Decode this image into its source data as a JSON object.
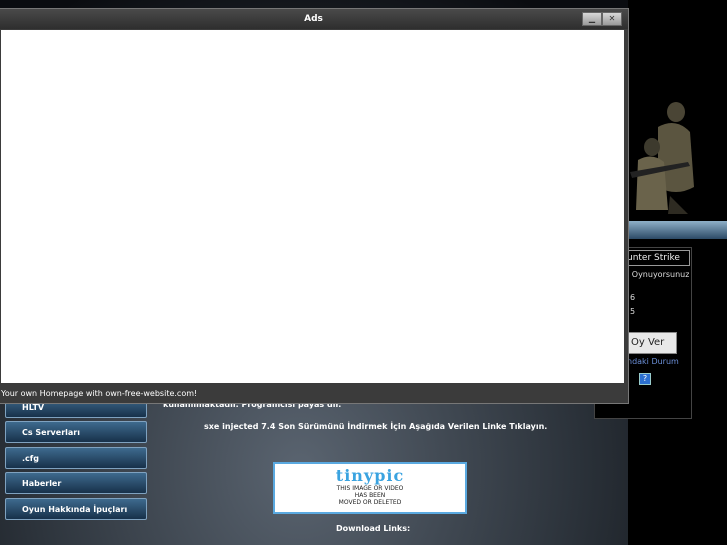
{
  "window": {
    "title": "Ads",
    "status_text": "Your own Homepage with own-free-website.com!",
    "minimize_icon": "minimize-icon",
    "close_icon": "close-icon"
  },
  "menu": {
    "items": [
      "HLTV",
      "Cs Serverları",
      ".cfg",
      "Haberler",
      "Oyun Hakkında İpuçları"
    ]
  },
  "content": {
    "line1": "kullanılmaktadır. Programcısı payas dır.",
    "line2": "sxe injected 7.4 Son Sürümünü İndirmek İçin Aşağıda Verilen Linke Tıklayın.",
    "download_label": "Download Links:"
  },
  "tinypic": {
    "logo": "tinypic",
    "message_line1": "THIS IMAGE OR VIDEO",
    "message_line2": "HAS BEEN",
    "message_line3": "MOVED OR DELETED"
  },
  "poll": {
    "title": "unter Strike",
    "question": "i Oynuyorsunuz?",
    "value1": "6",
    "value2": "5",
    "vote_button": "Oy Ver",
    "status_link": "ndaki Durum",
    "help_icon_text": "?"
  },
  "colors": {
    "window_bg": "#3b3b3b",
    "menu_button": "#2a4e6e",
    "link_blue": "#6b8fd8"
  }
}
